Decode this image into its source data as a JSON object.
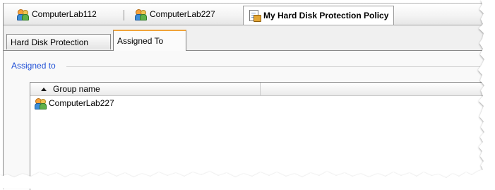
{
  "doc_tabs": [
    {
      "label": "ComputerLab112",
      "icon": "group-icon"
    },
    {
      "label": "ComputerLab227",
      "icon": "group-icon"
    },
    {
      "label": "My Hard Disk Protection Policy",
      "icon": "policy-icon",
      "active": true
    }
  ],
  "prop_tabs": [
    {
      "label": "Hard Disk Protection"
    },
    {
      "label": "Assigned To",
      "selected": true
    }
  ],
  "section": {
    "label": "Assigned to"
  },
  "list": {
    "columns": [
      "Group name"
    ],
    "sort": "ascending",
    "rows": [
      {
        "name": "ComputerLab227",
        "icon": "group-icon"
      }
    ]
  },
  "colors": {
    "accent": "#f0a33a",
    "section_label": "#1f4fd6"
  }
}
